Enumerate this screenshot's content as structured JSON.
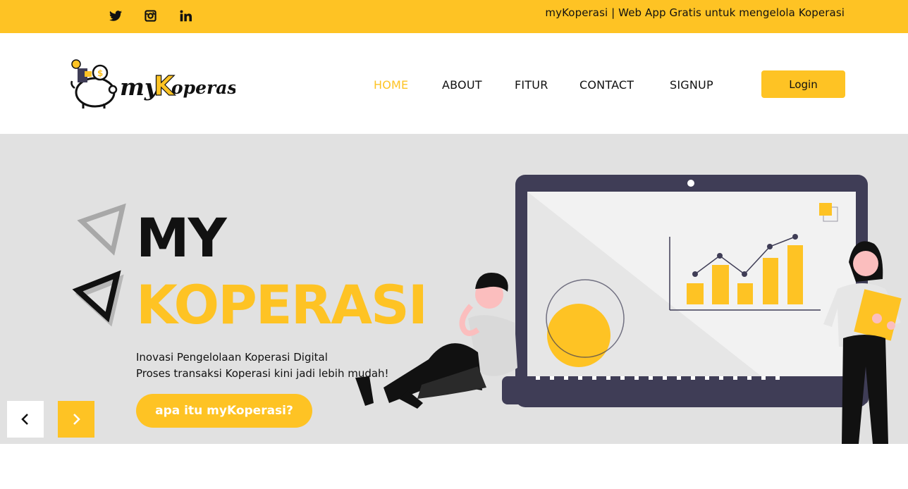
{
  "topbar": {
    "tagline": "myKoperasi | Web App Gratis untuk mengelola Koperasi",
    "social_icons": [
      "twitter-icon",
      "instagram-icon",
      "linkedin-icon"
    ]
  },
  "header": {
    "logo_text": "myKoperasi",
    "nav": [
      {
        "label": "HOME",
        "active": true
      },
      {
        "label": "ABOUT",
        "active": false
      },
      {
        "label": "FITUR",
        "active": false
      },
      {
        "label": "CONTACT",
        "active": false
      },
      {
        "label": "SIGNUP",
        "active": false
      }
    ],
    "login_label": "Login"
  },
  "hero": {
    "title_line1": "MY",
    "title_line2": "KOPERASI",
    "subtitle_line1": "Inovasi Pengelolaan Koperasi Digital",
    "subtitle_line2": "Proses transaksi Koperasi kini jadi lebih mudah!",
    "cta_label": "apa itu myKoperasi?",
    "prev_icon": "chevron-left-icon",
    "next_icon": "chevron-right-icon"
  },
  "colors": {
    "accent": "#fec324",
    "hero_bg": "#e1e1e1",
    "laptop": "#3f3d56",
    "text": "#111111"
  }
}
